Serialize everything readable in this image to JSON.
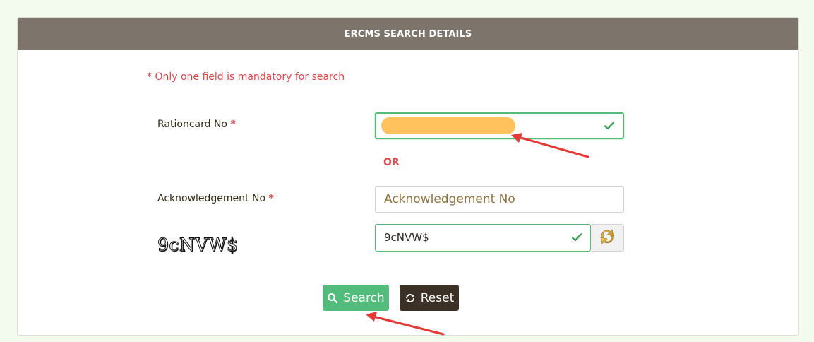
{
  "header": {
    "title": "ERCMS SEARCH DETAILS"
  },
  "form": {
    "note": "* Only one field is mandatory for search",
    "rationcard": {
      "label": "Rationcard No",
      "required_marker": "*",
      "value": ""
    },
    "or_label": "OR",
    "acknowledgement": {
      "label": "Acknowledgement No",
      "required_marker": "*",
      "placeholder": "Acknowledgement No",
      "value": ""
    },
    "captcha": {
      "image_text": "9cNVW$",
      "input_value": "9cNVW$"
    }
  },
  "buttons": {
    "search_label": "Search",
    "reset_label": "Reset"
  },
  "icons": {
    "valid_check": "check-icon",
    "refresh": "refresh-icon",
    "search": "search-icon",
    "reset": "refresh-icon"
  },
  "colors": {
    "header_bg": "#7d746c",
    "required": "#d9484d",
    "valid": "#52bc75",
    "search_button": "#52bc7d",
    "reset_button": "#3b3026",
    "annotation_arrow": "#e53935",
    "redaction": "#ffc25c"
  }
}
